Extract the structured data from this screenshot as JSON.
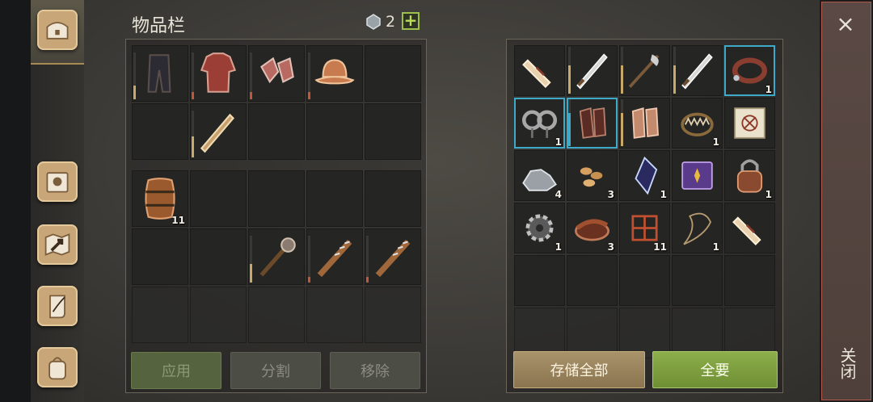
{
  "inventory": {
    "title": "物品栏",
    "gems": "2",
    "add": "+"
  },
  "buttons": {
    "apply": "应用",
    "split": "分割",
    "remove": "移除",
    "store_all": "存储全部",
    "take_all": "全要"
  },
  "close": {
    "x": "×",
    "label": "关闭"
  },
  "colors": {
    "durability_full": "#c8a96a",
    "durability_low": "#c0573b",
    "highlight": "#3fa9c9",
    "take_all": "#8dae4b"
  },
  "nav": [
    "chest-icon",
    "sun-book-icon",
    "map-arrow-icon",
    "scroll-quill-icon",
    "backpack-icon"
  ],
  "equip_slots": [
    "leather-leggings",
    "chainmail-shirt",
    "chainmail-gloves",
    "iron-helmet",
    "empty",
    "empty",
    "wooden-sword",
    "empty",
    "empty",
    "empty"
  ],
  "pack_slots": [
    {
      "icon": "barrel",
      "qty": "11"
    },
    {},
    {},
    {},
    {},
    {},
    {},
    {
      "icon": "spiked-mace"
    },
    {
      "icon": "spiked-club"
    },
    {
      "icon": "spiked-club"
    },
    {},
    {},
    {},
    {},
    {}
  ],
  "storage_slots": [
    {
      "icon": "scroll"
    },
    {
      "icon": "sword"
    },
    {
      "icon": "halberd"
    },
    {
      "icon": "sword"
    },
    {
      "icon": "leather-collar",
      "qty": "1"
    },
    {
      "icon": "shackles",
      "qty": "1"
    },
    {
      "icon": "leather-bracers"
    },
    {
      "icon": "chain-gloves"
    },
    {
      "icon": "bear-trap",
      "qty": "1"
    },
    {
      "icon": "map-blueprint"
    },
    {
      "icon": "stones",
      "qty": "4"
    },
    {
      "icon": "seeds",
      "qty": "3"
    },
    {
      "icon": "dark-crystal",
      "qty": "1"
    },
    {
      "icon": "purple-book"
    },
    {
      "icon": "padlock",
      "qty": "1"
    },
    {
      "icon": "gear",
      "qty": "1"
    },
    {
      "icon": "leather-roll",
      "qty": "3"
    },
    {
      "icon": "net-trap",
      "qty": "11"
    },
    {
      "icon": "rope-lasso",
      "qty": "1"
    },
    {
      "icon": "scroll"
    },
    {},
    {},
    {},
    {},
    {},
    {},
    {},
    {},
    {},
    {}
  ]
}
